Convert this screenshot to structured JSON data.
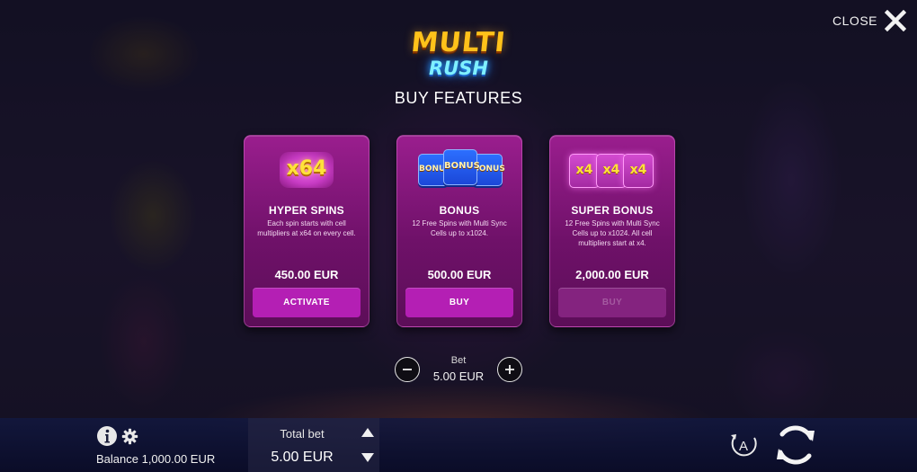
{
  "header": {
    "close_label": "CLOSE",
    "logo_top": "MULTI",
    "logo_bottom": "RUSH",
    "title": "BUY FEATURES"
  },
  "features": [
    {
      "icon_text": "x64",
      "title": "HYPER SPINS",
      "description": "Each spin starts with cell multipliers at x64 on every cell.",
      "price": "450.00 EUR",
      "button": "ACTIVATE",
      "button_enabled": true
    },
    {
      "icon_text": "BONUS",
      "title": "BONUS",
      "description": "12 Free Spins with Multi Sync Cells up to x1024.",
      "price": "500.00 EUR",
      "button": "BUY",
      "button_enabled": true
    },
    {
      "icon_text": "x4",
      "title": "SUPER BONUS",
      "description": "12 Free Spins with Multi Sync Cells up to x1024. All cell multipliers start at x4.",
      "price": "2,000.00 EUR",
      "button": "BUY",
      "button_enabled": false
    }
  ],
  "bet": {
    "label": "Bet",
    "value": "5.00 EUR"
  },
  "bottom_bar": {
    "balance": "Balance 1,000.00 EUR",
    "total_bet_label": "Total bet",
    "total_bet_value": "5.00 EUR",
    "autoplay_letter": "A"
  },
  "colors": {
    "card_bg": "#7a1474",
    "button_active": "#b41fb4",
    "button_disabled": "#84237f",
    "bottom_bar": "#121840"
  }
}
